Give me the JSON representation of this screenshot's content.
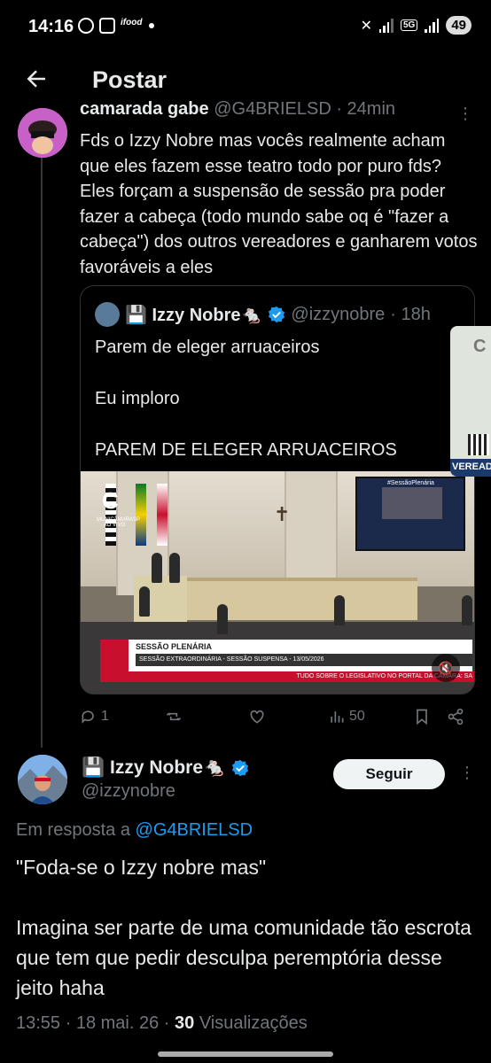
{
  "status_bar": {
    "time": "14:16",
    "battery": "49",
    "network": "5G",
    "app_icons": [
      "whatsapp-icon",
      "twitch-icon",
      "ifood-icon"
    ]
  },
  "header": {
    "title": "Postar",
    "back_icon": "arrow-left-icon"
  },
  "parent_post": {
    "author_name": "camarada gabe",
    "handle": "@G4BRIELSD",
    "time": "· 24min",
    "text": "Fds o Izzy Nobre mas vocês realmente acham que eles fazem esse teatro todo por puro fds? Eles forçam a suspensão de sessão pra poder fazer a cabeça (todo mundo sabe oq é \"fazer a cabeça\") dos outros vereadores e ganharem votos favoráveis a eles",
    "quoted": {
      "author_name": "💾 Izzy Nobre🐁",
      "handle": "@izzynobre",
      "time": "· 18h",
      "text": "Parem de eleger arruaceiros\n\nEu imploro\n\nPAREM DE ELEGER ARRUACEIROS",
      "video": {
        "brand": "C",
        "brand_sub": "MUNICÂMARASP AO VIVO",
        "lower_title": "SESSÃO PLENÁRIA",
        "lower_sub": "SESSÃO EXTRAORDINÁRIA - SESSÃO SUSPENSA - 13/05/2026",
        "ticker": "TUDO SOBRE O LEGISLATIVO NO PORTAL DA CÂMARA: SA",
        "screen_tag": "#SessãoPlenária"
      }
    },
    "side_tag": "VEREAD",
    "actions": {
      "replies": "1",
      "retweets": "",
      "likes": "",
      "views": "50"
    }
  },
  "main_post": {
    "author_name": "💾 Izzy Nobre🐁",
    "handle": "@izzynobre",
    "follow_label": "Seguir",
    "reply_prefix": "Em resposta a",
    "reply_to": "@G4BRIELSD",
    "text": "\"Foda-se o Izzy nobre mas\"\n\nImagina ser parte de uma comunidade tão escrota que tem que pedir desculpa peremptória desse jeito haha",
    "timestamp": "13:55 · 18 mai. 26 ·",
    "views_count": "30",
    "views_label": "Visualizações"
  },
  "colors": {
    "background": "#000000",
    "text": "#e7e9ea",
    "muted": "#71767b",
    "link": "#1d9bf0",
    "verified": "#1d9bf0"
  }
}
